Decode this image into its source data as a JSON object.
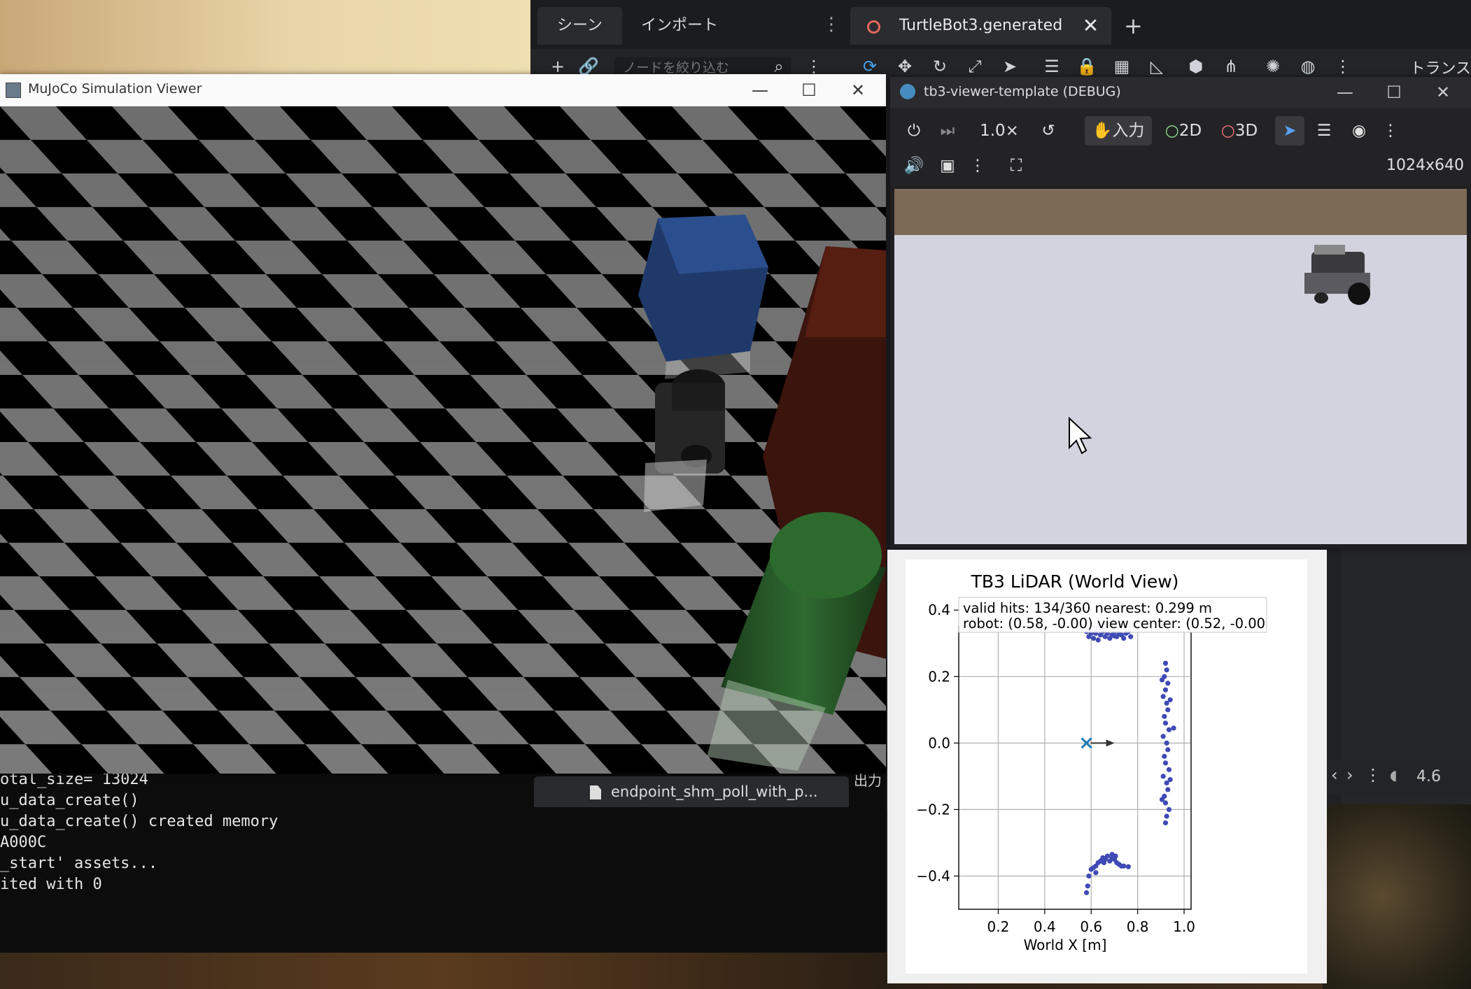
{
  "godot": {
    "tabs": [
      "シーン",
      "インポート"
    ],
    "doc_tab": "TurtleBot3.generated",
    "filter_placeholder": "ノードを絞り込む",
    "transform_label": "トランス",
    "output_tab": "endpoint_shm_poll_with_p...",
    "output_label": "出力",
    "version_badge": "4.6"
  },
  "mujoco": {
    "title": "MuJoCo Simulation Viewer"
  },
  "terminal": {
    "lines": [
      "otal_size= 13024",
      "u_data_create()",
      "u_data_create() created memory",
      "",
      "A000C",
      "_start' assets...",
      "ited with 0"
    ]
  },
  "game_window": {
    "title": "tb3-viewer-template (DEBUG)",
    "speed": "1.0×",
    "input_label": "入力",
    "mode_2d": "2D",
    "mode_3d": "3D",
    "resolution": "1024x640"
  },
  "colors": {
    "mujoco_floor_light": "#7a7a7a",
    "mujoco_floor_dark": "#000000",
    "godot_accent": "#478cbf",
    "lidar_points": "#3f4ab5"
  },
  "chart_data": {
    "type": "scatter",
    "title": "TB3 LiDAR (World View)",
    "xlabel": "World X [m]",
    "ylabel": "",
    "xlim": [
      0.03,
      1.03
    ],
    "ylim": [
      -0.5,
      0.35
    ],
    "xticks": [
      "0.2",
      "0.4",
      "0.6",
      "0.8",
      "1.0"
    ],
    "yticks": [
      "0.4",
      "0.2",
      "0.0",
      "−0.2",
      "−0.4"
    ],
    "grid": true,
    "info_line1": "valid hits: 134/360  nearest: 0.299 m",
    "info_line2": "robot: (0.58, -0.00)  view center: (0.52, -0.00",
    "robot": {
      "x": 0.58,
      "y": 0.0
    },
    "series": [
      {
        "points": [
          [
            0.58,
            0.335
          ],
          [
            0.59,
            0.32
          ],
          [
            0.6,
            0.33
          ],
          [
            0.61,
            0.315
          ],
          [
            0.62,
            0.33
          ],
          [
            0.63,
            0.31
          ],
          [
            0.64,
            0.325
          ],
          [
            0.65,
            0.335
          ],
          [
            0.66,
            0.32
          ],
          [
            0.67,
            0.33
          ],
          [
            0.68,
            0.315
          ],
          [
            0.69,
            0.325
          ],
          [
            0.7,
            0.335
          ],
          [
            0.71,
            0.32
          ],
          [
            0.72,
            0.33
          ],
          [
            0.73,
            0.325
          ],
          [
            0.74,
            0.315
          ],
          [
            0.75,
            0.33
          ],
          [
            0.76,
            0.335
          ],
          [
            0.77,
            0.32
          ],
          [
            0.59,
            0.34
          ],
          [
            0.62,
            0.34
          ],
          [
            0.66,
            0.34
          ],
          [
            0.7,
            0.322
          ],
          [
            0.92,
            0.24
          ],
          [
            0.925,
            0.22
          ],
          [
            0.915,
            0.2
          ],
          [
            0.93,
            0.18
          ],
          [
            0.92,
            0.16
          ],
          [
            0.91,
            0.14
          ],
          [
            0.925,
            0.12
          ],
          [
            0.93,
            0.1
          ],
          [
            0.915,
            0.08
          ],
          [
            0.92,
            0.06
          ],
          [
            0.935,
            0.04
          ],
          [
            0.91,
            0.02
          ],
          [
            0.925,
            0.0
          ],
          [
            0.93,
            -0.02
          ],
          [
            0.915,
            -0.04
          ],
          [
            0.92,
            -0.06
          ],
          [
            0.935,
            -0.08
          ],
          [
            0.91,
            -0.1
          ],
          [
            0.925,
            -0.12
          ],
          [
            0.93,
            -0.14
          ],
          [
            0.915,
            -0.16
          ],
          [
            0.92,
            -0.18
          ],
          [
            0.935,
            -0.2
          ],
          [
            0.925,
            -0.22
          ],
          [
            0.92,
            -0.24
          ],
          [
            0.955,
            0.045
          ],
          [
            0.94,
            0.13
          ],
          [
            0.94,
            -0.11
          ],
          [
            0.905,
            -0.17
          ],
          [
            0.905,
            0.19
          ],
          [
            0.58,
            -0.45
          ],
          [
            0.585,
            -0.43
          ],
          [
            0.59,
            -0.4
          ],
          [
            0.6,
            -0.38
          ],
          [
            0.61,
            -0.375
          ],
          [
            0.62,
            -0.37
          ],
          [
            0.63,
            -0.36
          ],
          [
            0.64,
            -0.355
          ],
          [
            0.65,
            -0.345
          ],
          [
            0.66,
            -0.35
          ],
          [
            0.67,
            -0.34
          ],
          [
            0.68,
            -0.355
          ],
          [
            0.69,
            -0.345
          ],
          [
            0.7,
            -0.35
          ],
          [
            0.71,
            -0.36
          ],
          [
            0.72,
            -0.365
          ],
          [
            0.73,
            -0.37
          ],
          [
            0.74,
            -0.37
          ],
          [
            0.76,
            -0.372
          ],
          [
            0.62,
            -0.39
          ],
          [
            0.655,
            -0.36
          ],
          [
            0.69,
            -0.335
          ],
          [
            0.705,
            -0.34
          ]
        ]
      }
    ]
  }
}
